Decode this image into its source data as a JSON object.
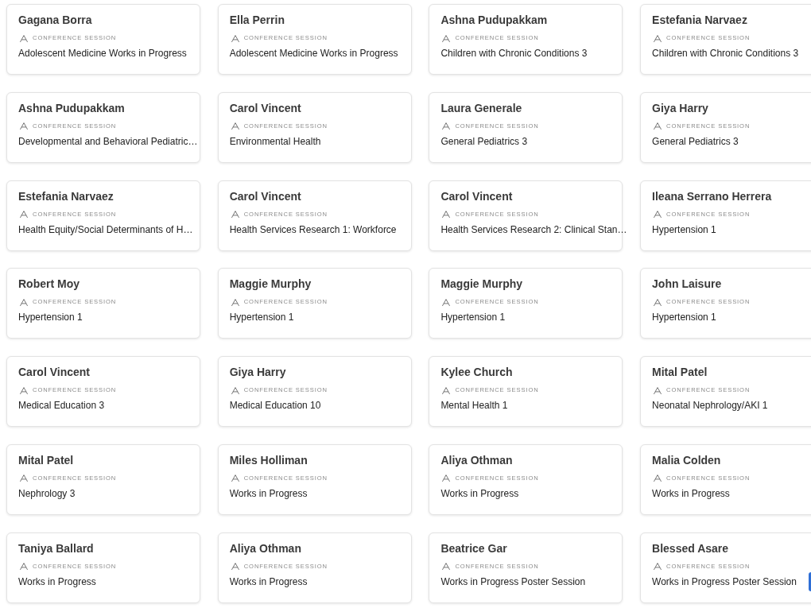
{
  "cards": [
    {
      "name": "Gagana Borra",
      "category": "CONFERENCE SESSION",
      "session": "Adolescent Medicine Works in Progress"
    },
    {
      "name": "Ella Perrin",
      "category": "CONFERENCE SESSION",
      "session": "Adolescent Medicine Works in Progress"
    },
    {
      "name": "Ashna Pudupakkam",
      "category": "CONFERENCE SESSION",
      "session": "Children with Chronic Conditions 3"
    },
    {
      "name": "Estefania Narvaez",
      "category": "CONFERENCE SESSION",
      "session": "Children with Chronic Conditions 3"
    },
    {
      "name": "Ashna Pudupakkam",
      "category": "CONFERENCE SESSION",
      "session": "Developmental and Behavioral Pediatric…"
    },
    {
      "name": "Carol Vincent",
      "category": "CONFERENCE SESSION",
      "session": "Environmental Health"
    },
    {
      "name": "Laura Generale",
      "category": "CONFERENCE SESSION",
      "session": "General Pediatrics 3"
    },
    {
      "name": "Giya Harry",
      "category": "CONFERENCE SESSION",
      "session": "General Pediatrics 3"
    },
    {
      "name": "Estefania Narvaez",
      "category": "CONFERENCE SESSION",
      "session": "Health Equity/Social Determinants of H…"
    },
    {
      "name": "Carol Vincent",
      "category": "CONFERENCE SESSION",
      "session": "Health Services Research 1: Workforce"
    },
    {
      "name": "Carol Vincent",
      "category": "CONFERENCE SESSION",
      "session": "Health Services Research 2: Clinical Stan…"
    },
    {
      "name": "Ileana Serrano Herrera",
      "category": "CONFERENCE SESSION",
      "session": "Hypertension 1"
    },
    {
      "name": "Robert Moy",
      "category": "CONFERENCE SESSION",
      "session": "Hypertension 1"
    },
    {
      "name": "Maggie Murphy",
      "category": "CONFERENCE SESSION",
      "session": "Hypertension 1"
    },
    {
      "name": "Maggie Murphy",
      "category": "CONFERENCE SESSION",
      "session": "Hypertension 1"
    },
    {
      "name": "John Laisure",
      "category": "CONFERENCE SESSION",
      "session": "Hypertension 1"
    },
    {
      "name": "Carol Vincent",
      "category": "CONFERENCE SESSION",
      "session": "Medical Education 3"
    },
    {
      "name": "Giya Harry",
      "category": "CONFERENCE SESSION",
      "session": "Medical Education 10"
    },
    {
      "name": "Kylee Church",
      "category": "CONFERENCE SESSION",
      "session": "Mental Health 1"
    },
    {
      "name": "Mital Patel",
      "category": "CONFERENCE SESSION",
      "session": "Neonatal Nephrology/AKI 1"
    },
    {
      "name": "Mital Patel",
      "category": "CONFERENCE SESSION",
      "session": "Nephrology 3"
    },
    {
      "name": "Miles Holliman",
      "category": "CONFERENCE SESSION",
      "session": "Works in Progress"
    },
    {
      "name": "Aliya Othman",
      "category": "CONFERENCE SESSION",
      "session": "Works in Progress"
    },
    {
      "name": "Malia Colden",
      "category": "CONFERENCE SESSION",
      "session": "Works in Progress"
    },
    {
      "name": "Taniya Ballard",
      "category": "CONFERENCE SESSION",
      "session": "Works in Progress"
    },
    {
      "name": "Aliya Othman",
      "category": "CONFERENCE SESSION",
      "session": "Works in Progress"
    },
    {
      "name": "Beatrice Gar",
      "category": "CONFERENCE SESSION",
      "session": "Works in Progress Poster Session"
    },
    {
      "name": "Blessed Asare",
      "category": "CONFERENCE SESSION",
      "session": "Works in Progress Poster Session"
    }
  ]
}
